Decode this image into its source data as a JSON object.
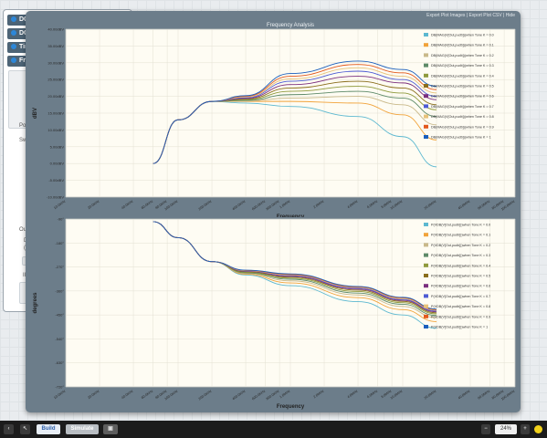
{
  "sidebar": {
    "items": [
      {
        "label": "DC"
      },
      {
        "label": "DC"
      },
      {
        "label": "Tin"
      },
      {
        "label": "Fr"
      }
    ],
    "fragments": [
      "Poi",
      "Swe",
      "Ou",
      "D",
      "(e",
      "Ill"
    ]
  },
  "toolbar": {
    "export_images": "Export Plot Images",
    "export_csv": "Export Plot CSV",
    "hide": "Hide",
    "sep": "|"
  },
  "taskbar": {
    "build": "Build",
    "simulate": "Simulate",
    "zoom": "24%"
  },
  "colors": {
    "series": [
      "#5cb8d0",
      "#f1a33a",
      "#c9b98a",
      "#5d8a68",
      "#8f9a3c",
      "#8a6e1c",
      "#7b2f7e",
      "#4d5bd4",
      "#e7c27a",
      "#e3591d",
      "#1b5fbd"
    ]
  },
  "chart_data": [
    {
      "type": "line",
      "title": "Frequency Analysis",
      "xlabel": "Frequency",
      "ylabel": "dBV",
      "x_scale": "log",
      "x_ticks": [
        "10.0KHz",
        "20.0KHz",
        "40.0KHz",
        "60.0KHz",
        "80.0KHz",
        "100.0KHz",
        "200.0KHz",
        "400.0KHz",
        "600.0KHz",
        "800.0KHz",
        "1.0MHz",
        "2.0MHz",
        "4.0MHz",
        "6.0MHz",
        "8.0MHz",
        "10.0MHz",
        "20.0MHz",
        "40.0MHz",
        "60.0MHz",
        "80.0MHz",
        "100.0MHz"
      ],
      "y_ticks": [
        "-10.00dBV",
        "-5.00dBV",
        "0.00dBV",
        "5.00dBV",
        "10.00dBV",
        "15.00dBV",
        "20.00dBV",
        "25.00dBV",
        "30.00dBV",
        "35.00dBV",
        "40.00dBV"
      ],
      "ylim": [
        -10,
        40
      ],
      "legend_position": "right",
      "series": [
        {
          "name": "DB(MAG(V[Out,pudb]))when Tone K = 0.0",
          "x": [
            60000,
            100000,
            200000,
            400000,
            1000000,
            4000000,
            10000000,
            20000000
          ],
          "y": [
            0,
            13.0,
            18.5,
            18.0,
            17.0,
            14.0,
            8.0,
            -1.0
          ]
        },
        {
          "name": "DB(MAG(V[Out,pudb]))when Tone K = 0.1",
          "x": [
            60000,
            100000,
            200000,
            400000,
            1000000,
            4000000,
            10000000,
            20000000
          ],
          "y": [
            0,
            13.0,
            18.5,
            18.5,
            18.5,
            18.0,
            14.5,
            7.0
          ]
        },
        {
          "name": "DB(MAG(V[Out,pudb]))when Tone K = 0.2",
          "x": [
            60000,
            100000,
            200000,
            400000,
            1000000,
            4000000,
            10000000,
            20000000
          ],
          "y": [
            0,
            13.0,
            18.5,
            18.6,
            19.5,
            20.0,
            17.5,
            11.5
          ]
        },
        {
          "name": "DB(MAG(V[Out,pudb]))when Tone K = 0.3",
          "x": [
            60000,
            100000,
            200000,
            400000,
            1000000,
            4000000,
            10000000,
            20000000
          ],
          "y": [
            0,
            13.0,
            18.5,
            18.8,
            20.5,
            21.5,
            19.5,
            14.0
          ]
        },
        {
          "name": "DB(MAG(V[Out,pudb]))when Tone K = 0.4",
          "x": [
            60000,
            100000,
            200000,
            400000,
            1000000,
            4000000,
            10000000,
            20000000
          ],
          "y": [
            0,
            13.0,
            18.5,
            19.0,
            21.5,
            23.0,
            21.0,
            16.0
          ]
        },
        {
          "name": "DB(MAG(V[Out,pudb]))when Tone K = 0.5",
          "x": [
            60000,
            100000,
            200000,
            400000,
            1000000,
            4000000,
            10000000,
            20000000
          ],
          "y": [
            0,
            13.0,
            18.5,
            19.2,
            22.5,
            24.5,
            22.5,
            17.5
          ]
        },
        {
          "name": "DB(MAG(V[Out,pudb]))when Tone K = 0.6",
          "x": [
            60000,
            100000,
            200000,
            400000,
            1000000,
            4000000,
            10000000,
            20000000
          ],
          "y": [
            0,
            13.0,
            18.5,
            19.4,
            23.5,
            26.0,
            24.0,
            19.0
          ]
        },
        {
          "name": "DB(MAG(V[Out,pudb]))when Tone K = 0.7",
          "x": [
            60000,
            100000,
            200000,
            400000,
            1000000,
            4000000,
            10000000,
            20000000
          ],
          "y": [
            0,
            13.0,
            18.5,
            19.6,
            24.5,
            27.5,
            25.0,
            20.0
          ]
        },
        {
          "name": "DB(MAG(V[Out,pudb]))when Tone K = 0.8",
          "x": [
            60000,
            100000,
            200000,
            400000,
            1000000,
            4000000,
            10000000,
            20000000
          ],
          "y": [
            0,
            13.0,
            18.5,
            19.8,
            25.2,
            28.5,
            26.0,
            21.0
          ]
        },
        {
          "name": "DB(MAG(V[Out,pudb]))when Tone K = 0.9",
          "x": [
            60000,
            100000,
            200000,
            400000,
            1000000,
            4000000,
            10000000,
            20000000
          ],
          "y": [
            0,
            13.0,
            18.5,
            20.0,
            26.0,
            29.5,
            27.0,
            22.0
          ]
        },
        {
          "name": "DB(MAG(V[Out,pudb]))when Tone K = 1",
          "x": [
            60000,
            100000,
            200000,
            400000,
            1000000,
            4000000,
            10000000,
            20000000
          ],
          "y": [
            0,
            13.0,
            18.5,
            20.2,
            26.8,
            30.5,
            28.0,
            23.0
          ]
        }
      ]
    },
    {
      "type": "line",
      "xlabel": "Frequency",
      "ylabel": "degrees",
      "x_scale": "log",
      "x_ticks": [
        "10.0KHz",
        "20.0KHz",
        "40.0KHz",
        "60.0KHz",
        "80.0KHz",
        "100.0KHz",
        "200.0KHz",
        "400.0KHz",
        "600.0KHz",
        "800.0KHz",
        "1.0MHz",
        "2.0MHz",
        "4.0MHz",
        "6.0MHz",
        "8.0MHz",
        "10.0MHz",
        "20.0MHz",
        "40.0MHz",
        "60.0MHz",
        "80.0MHz",
        "100.0MHz"
      ],
      "y_ticks": [
        "-90°",
        "-180°",
        "-270°",
        "-360°",
        "-450°",
        "-540°",
        "-630°",
        "-720°"
      ],
      "ylim": [
        -720,
        -90
      ],
      "legend_position": "right",
      "series": [
        {
          "name": "P(VDB(V[Out,pudb]))when Tone K = 0.0",
          "x": [
            60000,
            100000,
            200000,
            400000,
            1000000,
            4000000,
            10000000,
            20000000
          ],
          "y": [
            -100,
            -160,
            -250,
            -300,
            -340,
            -400,
            -450,
            -500
          ]
        },
        {
          "name": "P(VDB(V[Out,pudb]))when Tone K = 0.1",
          "x": [
            60000,
            100000,
            200000,
            400000,
            1000000,
            4000000,
            10000000,
            20000000
          ],
          "y": [
            -100,
            -160,
            -250,
            -297,
            -330,
            -385,
            -430,
            -475
          ]
        },
        {
          "name": "P(VDB(V[Out,pudb]))when Tone K = 0.2",
          "x": [
            60000,
            100000,
            200000,
            400000,
            1000000,
            4000000,
            10000000,
            20000000
          ],
          "y": [
            -100,
            -160,
            -250,
            -294,
            -322,
            -375,
            -418,
            -460
          ]
        },
        {
          "name": "P(VDB(V[Out,pudb]))when Tone K = 0.3",
          "x": [
            60000,
            100000,
            200000,
            400000,
            1000000,
            4000000,
            10000000,
            20000000
          ],
          "y": [
            -100,
            -160,
            -250,
            -292,
            -316,
            -368,
            -410,
            -452
          ]
        },
        {
          "name": "P(VDB(V[Out,pudb]))when Tone K = 0.4",
          "x": [
            60000,
            100000,
            200000,
            400000,
            1000000,
            4000000,
            10000000,
            20000000
          ],
          "y": [
            -100,
            -160,
            -250,
            -290,
            -312,
            -362,
            -404,
            -446
          ]
        },
        {
          "name": "P(VDB(V[Out,pudb]))when Tone K = 0.5",
          "x": [
            60000,
            100000,
            200000,
            400000,
            1000000,
            4000000,
            10000000,
            20000000
          ],
          "y": [
            -100,
            -160,
            -250,
            -288,
            -308,
            -357,
            -399,
            -442
          ]
        },
        {
          "name": "P(VDB(V[Out,pudb]))when Tone K = 0.6",
          "x": [
            60000,
            100000,
            200000,
            400000,
            1000000,
            4000000,
            10000000,
            20000000
          ],
          "y": [
            -100,
            -160,
            -250,
            -286,
            -305,
            -353,
            -395,
            -438
          ]
        },
        {
          "name": "P(VDB(V[Out,pudb]))when Tone K = 0.7",
          "x": [
            60000,
            100000,
            200000,
            400000,
            1000000,
            4000000,
            10000000,
            20000000
          ],
          "y": [
            -100,
            -160,
            -250,
            -285,
            -302,
            -350,
            -392,
            -435
          ]
        },
        {
          "name": "P(VDB(V[Out,pudb]))when Tone K = 0.8",
          "x": [
            60000,
            100000,
            200000,
            400000,
            1000000,
            4000000,
            10000000,
            20000000
          ],
          "y": [
            -100,
            -160,
            -250,
            -284,
            -300,
            -347,
            -389,
            -432
          ]
        },
        {
          "name": "P(VDB(V[Out,pudb]))when Tone K = 0.9",
          "x": [
            60000,
            100000,
            200000,
            400000,
            1000000,
            4000000,
            10000000,
            20000000
          ],
          "y": [
            -100,
            -160,
            -250,
            -283,
            -298,
            -345,
            -386,
            -430
          ]
        },
        {
          "name": "P(VDB(V[Out,pudb]))when Tone K = 1",
          "x": [
            60000,
            100000,
            200000,
            400000,
            1000000,
            4000000,
            10000000,
            20000000
          ],
          "y": [
            -100,
            -160,
            -250,
            -282,
            -296,
            -343,
            -384,
            -428
          ]
        }
      ]
    }
  ]
}
